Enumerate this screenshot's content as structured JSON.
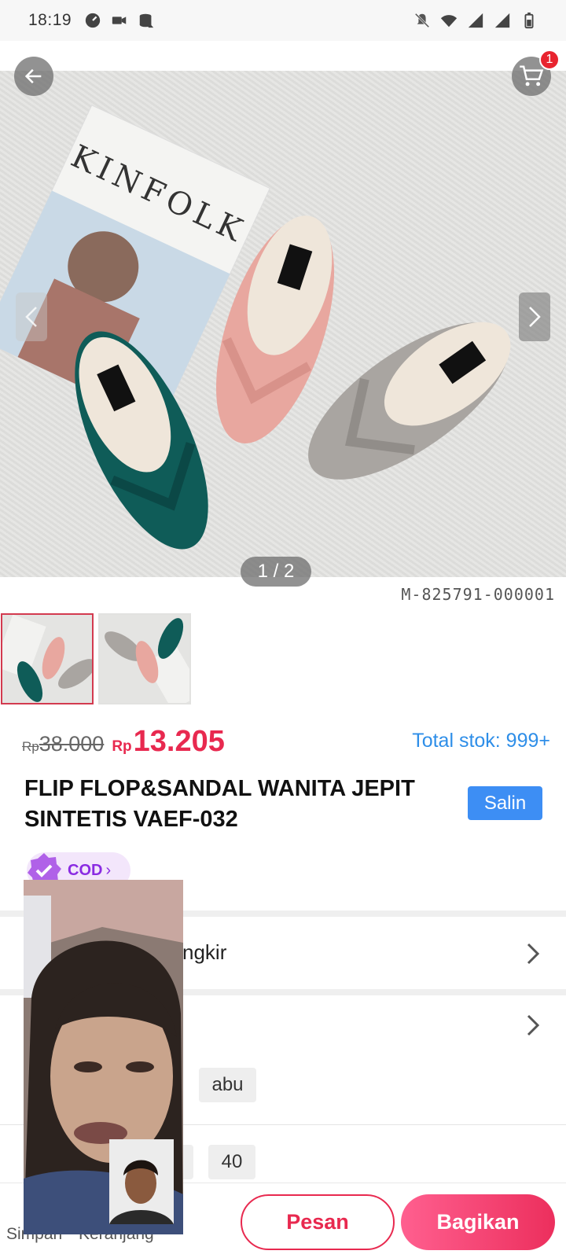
{
  "status_bar": {
    "time": "18:19",
    "icons_left": [
      "speed-icon",
      "video-camera-icon",
      "data-saver-icon"
    ],
    "icons_right": [
      "mute-icon",
      "wifi-icon",
      "signal-icon",
      "signal-icon",
      "battery-icon"
    ]
  },
  "top_nav": {
    "cart_count": "1"
  },
  "gallery": {
    "pager": "1 / 2",
    "watermark_code": "M-825791-000001",
    "photo_magazine_text": "KINFOLK"
  },
  "price": {
    "original_currency": "Rp",
    "original_value": "38.000",
    "sale_currency": "Rp",
    "sale_value": "13.205",
    "stock_text": "Total stok: 999+"
  },
  "product": {
    "title_line1": "FLIP FLOP&SANDAL WANITA JEPIT",
    "title_line2": "SINTETIS VAEF-032",
    "copy_label": "Salin"
  },
  "badges": {
    "cod_label": "COD"
  },
  "sections": {
    "shipping_text_visible": "ngkir",
    "variant_color_visible": "abu",
    "variant_size_visible": "40"
  },
  "bottom_bar": {
    "save_label": "Simpan",
    "cart_label": "Keranjang",
    "order_label": "Pesan",
    "share_label": "Bagikan"
  },
  "colors": {
    "accent_pink": "#e8294f",
    "link_blue": "#2e8ee8",
    "copy_button_blue": "#3d8ef4",
    "cod_purple": "#8a2be2"
  }
}
